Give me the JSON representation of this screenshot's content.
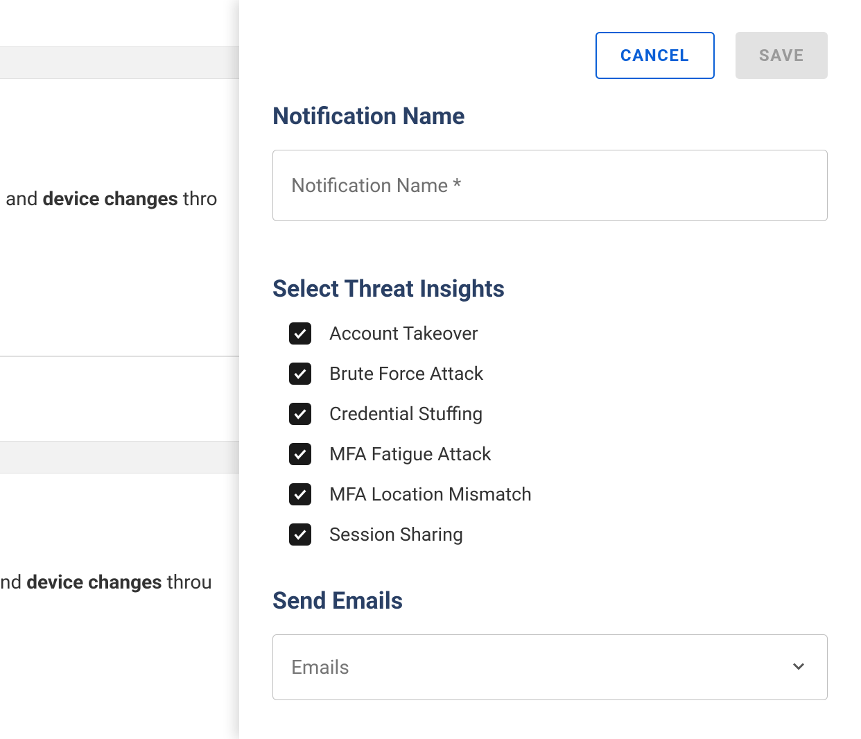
{
  "background": {
    "text_fragment_1_prefix": "and ",
    "text_fragment_1_bold": "device changes",
    "text_fragment_1_suffix": " thro",
    "text_fragment_2_prefix": "nd ",
    "text_fragment_2_bold": "device changes",
    "text_fragment_2_suffix": " throu"
  },
  "panel": {
    "actions": {
      "cancel_label": "CANCEL",
      "save_label": "SAVE"
    },
    "name_section": {
      "title": "Notification Name",
      "placeholder": "Notification Name *",
      "value": ""
    },
    "threat_section": {
      "title": "Select Threat Insights",
      "items": [
        {
          "label": "Account Takeover",
          "checked": true
        },
        {
          "label": "Brute Force Attack",
          "checked": true
        },
        {
          "label": "Credential Stuffing",
          "checked": true
        },
        {
          "label": "MFA Fatigue Attack",
          "checked": true
        },
        {
          "label": "MFA Location Mismatch",
          "checked": true
        },
        {
          "label": "Session Sharing",
          "checked": true
        }
      ]
    },
    "emails_section": {
      "title": "Send Emails",
      "placeholder": "Emails",
      "value": ""
    }
  }
}
